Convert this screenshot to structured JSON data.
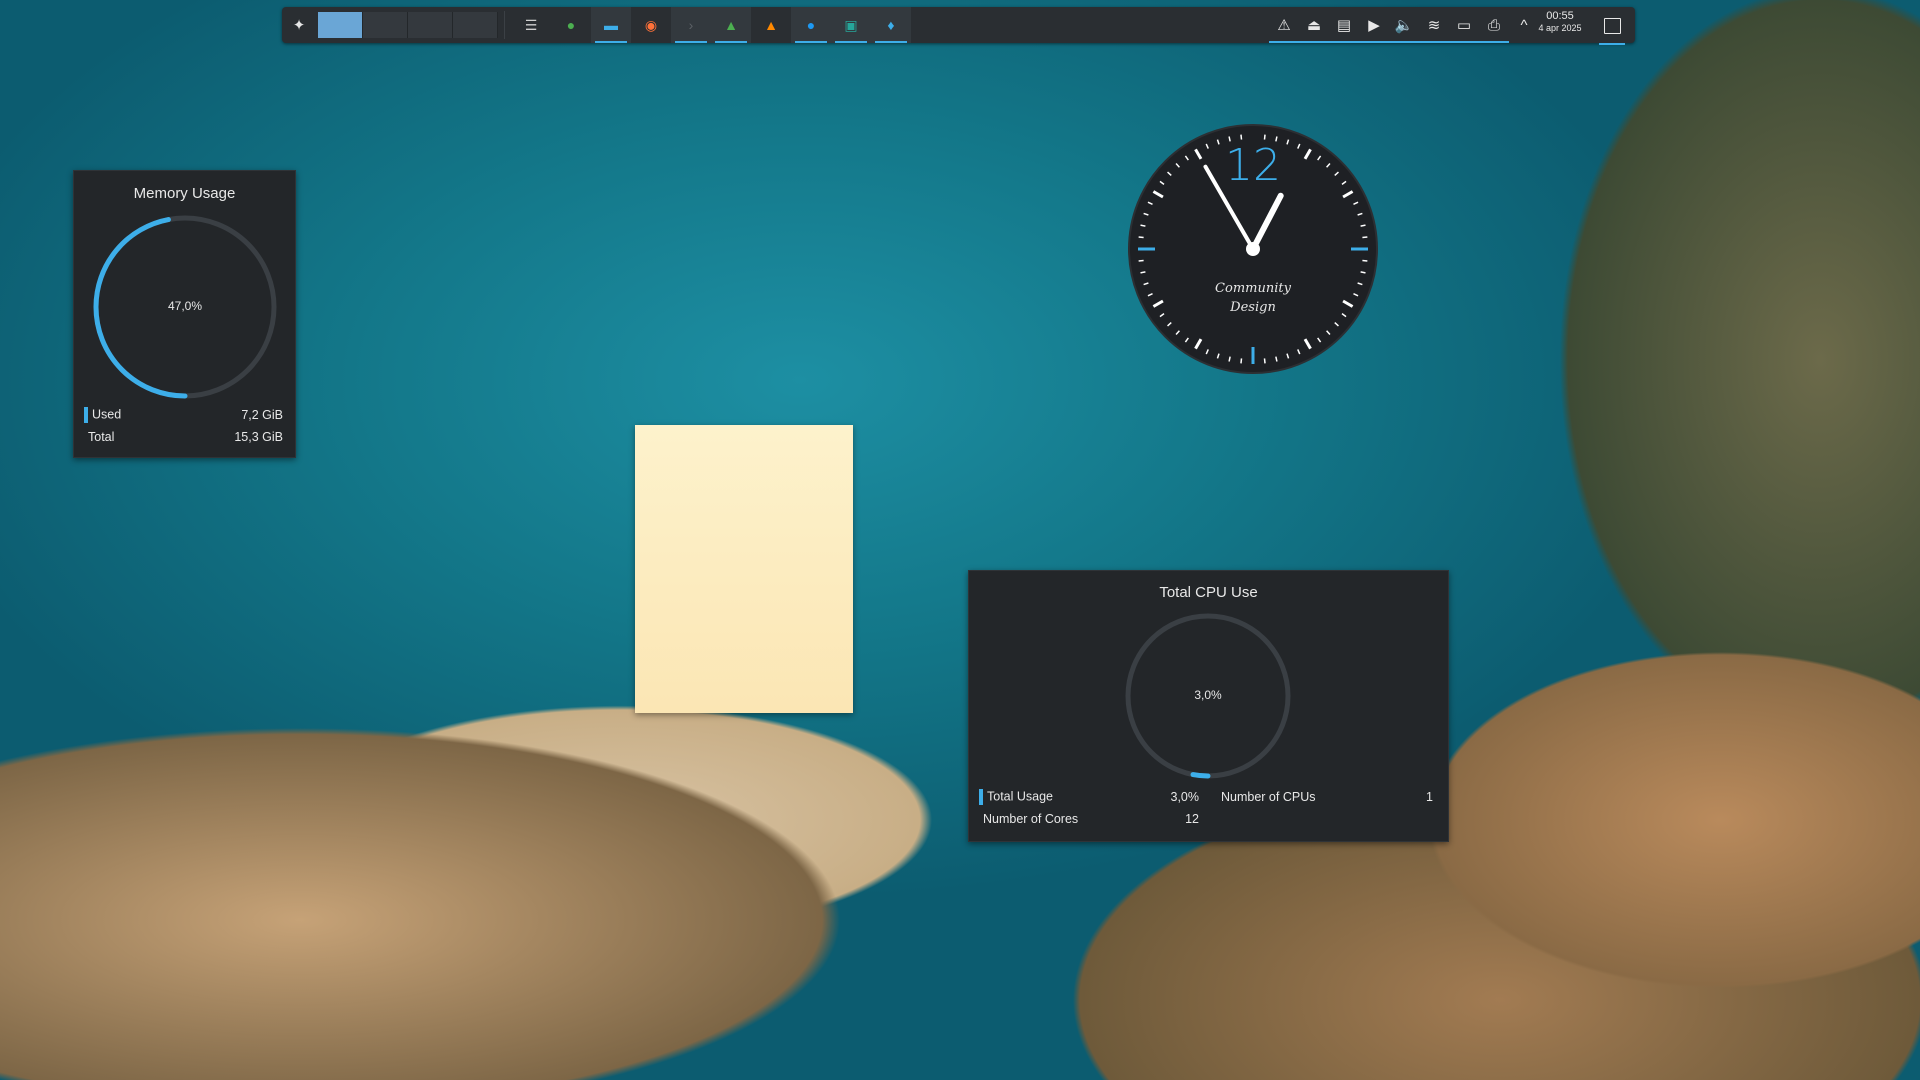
{
  "panel": {
    "launcher_icon": "application-launcher-icon",
    "virtual_desktops": 4,
    "active_desktop": 1,
    "tasks": [
      {
        "name": "windows-list-icon",
        "color": "#cfcfcf",
        "glyph": "☰",
        "running": false
      },
      {
        "name": "green-circle-app-icon",
        "color": "#4caf50",
        "glyph": "●",
        "running": false
      },
      {
        "name": "file-manager-icon",
        "color": "#3daee9",
        "glyph": "▬",
        "running": true
      },
      {
        "name": "firefox-icon",
        "color": "#ff7139",
        "glyph": "◉",
        "running": false
      },
      {
        "name": "terminal-icon",
        "color": "#5c6166",
        "glyph": "›",
        "running": true
      },
      {
        "name": "system-monitor-icon",
        "color": "#4caf50",
        "glyph": "▲",
        "running": true
      },
      {
        "name": "vlc-icon",
        "color": "#ff8800",
        "glyph": "▲",
        "running": false
      },
      {
        "name": "blue-sphere-app-icon",
        "color": "#1d99f3",
        "glyph": "●",
        "running": true
      },
      {
        "name": "screen-sharing-icon",
        "color": "#26a69a",
        "glyph": "▣",
        "running": true
      },
      {
        "name": "water-drop-app-icon",
        "color": "#3daee9",
        "glyph": "♦",
        "running": true
      }
    ],
    "tray": [
      {
        "name": "notification-bell-icon",
        "glyph": "⚠"
      },
      {
        "name": "vpn-cone-icon",
        "glyph": "⏏"
      },
      {
        "name": "clipboard-icon",
        "glyph": "▤"
      },
      {
        "name": "media-play-icon",
        "glyph": "▶"
      },
      {
        "name": "volume-icon",
        "glyph": "🔈"
      },
      {
        "name": "wifi-icon",
        "glyph": "≋"
      },
      {
        "name": "display-settings-icon",
        "glyph": "▭"
      },
      {
        "name": "printer-icon",
        "glyph": "⎙"
      },
      {
        "name": "expand-tray-icon",
        "glyph": "^"
      }
    ],
    "clock": {
      "time": "00:55",
      "date": "4 apr 2025"
    }
  },
  "memory_widget": {
    "title": "Memory Usage",
    "percent_label": "47,0%",
    "fraction": 0.47,
    "rows": [
      {
        "label": "Used",
        "value": "7,2 GiB",
        "color": "#3daee9"
      },
      {
        "label": "Total",
        "value": "15,3 GiB"
      }
    ]
  },
  "cpu_widget": {
    "title": "Total CPU Use",
    "percent_label": "3,0%",
    "fraction": 0.03,
    "rows": [
      {
        "label": "Total Usage",
        "value": "3,0%",
        "color": "#3daee9"
      },
      {
        "label": "Number of Cores",
        "value": "12"
      }
    ],
    "right_rows": [
      {
        "label": "Number of CPUs",
        "value": "1"
      }
    ]
  },
  "analog_clock": {
    "numeral": "12",
    "brand_line1": "Community",
    "brand_line2": "Design",
    "hour": 0,
    "minute": 55
  },
  "colors": {
    "accent": "#3daee9",
    "widget_bg": "#232629",
    "panel_bg": "#2a2e32",
    "note": "#fbe8b8"
  }
}
